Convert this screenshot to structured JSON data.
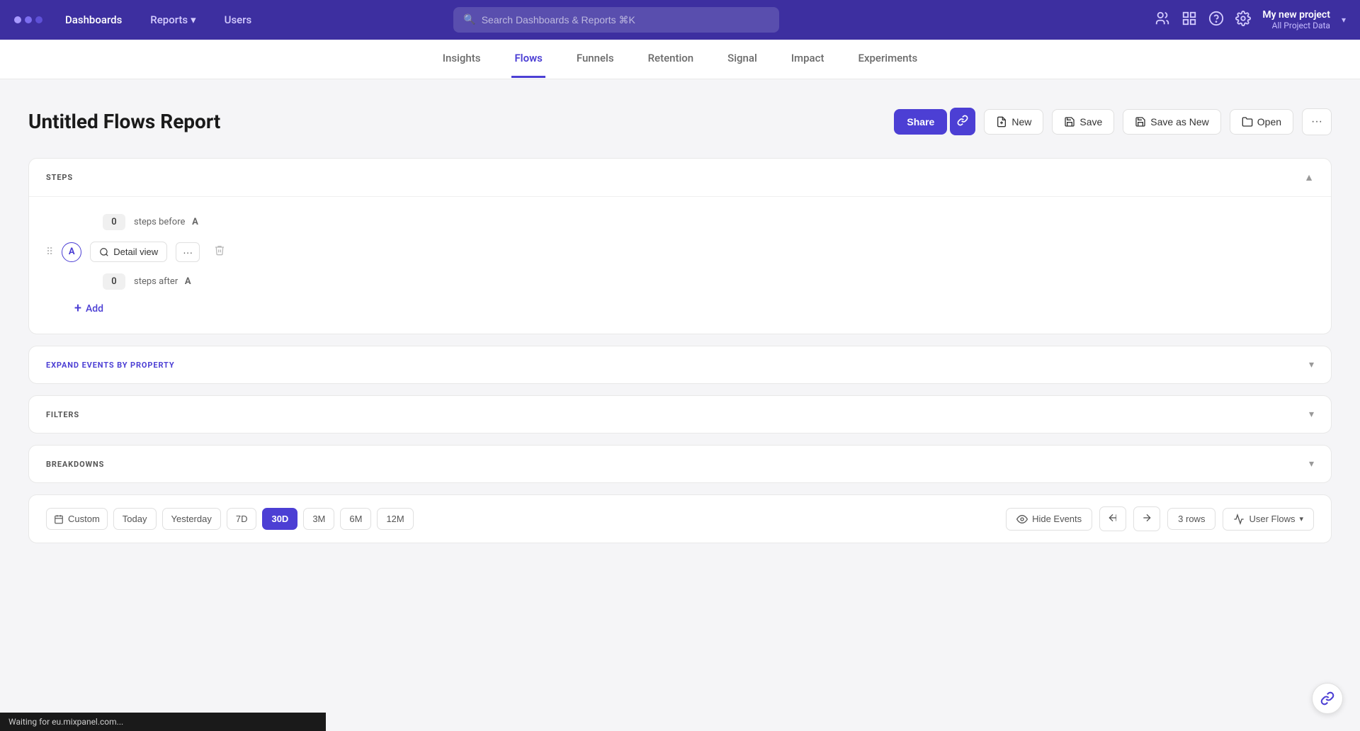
{
  "nav": {
    "dots": [
      "dot1",
      "dot2",
      "dot3"
    ],
    "items": [
      {
        "label": "Dashboards",
        "active": false
      },
      {
        "label": "Reports",
        "active": true
      },
      {
        "label": "Users",
        "active": false
      }
    ],
    "search_placeholder": "Search Dashboards & Reports ⌘K",
    "project_name": "My new project",
    "project_sub": "All Project Data"
  },
  "sub_nav": {
    "items": [
      {
        "label": "Insights",
        "active": false
      },
      {
        "label": "Flows",
        "active": true
      },
      {
        "label": "Funnels",
        "active": false
      },
      {
        "label": "Retention",
        "active": false
      },
      {
        "label": "Signal",
        "active": false
      },
      {
        "label": "Impact",
        "active": false
      },
      {
        "label": "Experiments",
        "active": false
      }
    ]
  },
  "report": {
    "title": "Untitled Flows Report",
    "actions": {
      "share": "Share",
      "new": "New",
      "save": "Save",
      "save_as_new": "Save as New",
      "open": "Open",
      "more": "···"
    }
  },
  "steps_section": {
    "title": "STEPS",
    "steps_before_label": "steps before",
    "steps_after_label": "steps after",
    "step_letter": "A",
    "steps_before_count": "0",
    "steps_after_count": "0",
    "detail_view_label": "Detail view",
    "add_label": "Add"
  },
  "expand_section": {
    "title": "EXPAND EVENTS BY PROPERTY"
  },
  "filters_section": {
    "title": "FILTERS"
  },
  "breakdowns_section": {
    "title": "BREAKDOWNS"
  },
  "toolbar": {
    "calendar_label": "Custom",
    "time_buttons": [
      {
        "label": "Today",
        "active": false
      },
      {
        "label": "Yesterday",
        "active": false
      },
      {
        "label": "7D",
        "active": false
      },
      {
        "label": "30D",
        "active": true
      },
      {
        "label": "3M",
        "active": false
      },
      {
        "label": "6M",
        "active": false
      },
      {
        "label": "12M",
        "active": false
      }
    ],
    "hide_events": "Hide Events",
    "rows": "3 rows",
    "user_flows": "User Flows"
  },
  "status_bar": {
    "text": "Waiting for eu.mixpanel.com..."
  }
}
